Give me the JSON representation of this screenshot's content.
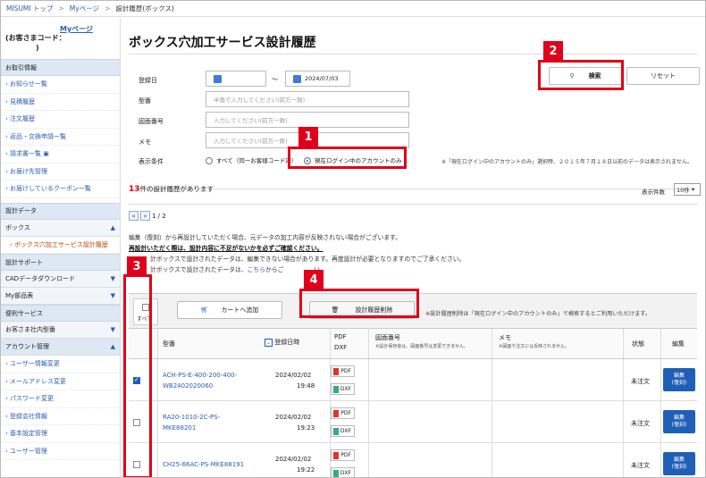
{
  "breadcrumb": {
    "home": "MISUMI トップ",
    "my": "Myページ",
    "current": "設計履歴(ボックス)"
  },
  "sidebar": {
    "mypage": "Myページ",
    "customer_label": "(お客さまコード：",
    "customer_close": ")",
    "sections": [
      {
        "title": "お取引情報",
        "items": [
          "お知らせ一覧",
          "見積履歴",
          "注文履歴",
          "返品・交換申請一覧",
          "請求書一覧",
          "お届け先管理",
          "お届けしているクーポン一覧"
        ]
      },
      {
        "title": "設計データ"
      }
    ],
    "box": "ボックス",
    "box_sub": "ボックス穴加工サービス設計履歴",
    "support": "設計サポート",
    "cad": "CADデータダウンロード",
    "myparts": "My部品表",
    "services": "便利サービス",
    "customer_items": "お客さま社内型番",
    "account": "アカウント管理",
    "account_items": [
      "ユーザー情報変更",
      "メールアドレス変更",
      "パスワード変更",
      "登録会社情報",
      "基本設定管理",
      "ユーザー管理"
    ]
  },
  "page": {
    "title": "ボックス穴加工サービス設計履歴"
  },
  "search": {
    "date_label": "登録日",
    "date_to": "2024/07/03",
    "tilde": "～",
    "part_label": "型番",
    "part_ph": "半角で入力してください(前方一致)",
    "drawing_label": "図面番号",
    "drawing_ph": "入力してください(前方一致)",
    "memo_label": "メモ",
    "memo_ph": "入力してください(前方一致)",
    "cond_label": "表示条件",
    "opt_all": "すべて（同一お客様コード内）",
    "opt_mine": "現在ログイン中のアカウントのみ",
    "note": "※「現在ログイン中のアカウントのみ」選択時、２０１５年７月１８日以前のデータは表示されません。",
    "search_btn": "検索",
    "reset_btn": "リセット"
  },
  "results": {
    "count": "13",
    "count_suffix": "件の設計履歴があります",
    "per_page_label": "表示件数",
    "per_page": "10件",
    "page": "1 / 2",
    "msg1": "編集（復刻）から再設計していただく場合、元データの加工内容が反映されない場合がございます。",
    "msg2": "再設計いただく際は、設計内容に不足がないかを必ずご確認ください。",
    "msg3": "計ボックスで設計されたデータは、編集できない場合があります。再度設計が必要となりますのでご了承ください。",
    "msg4a": "計ボックスで設計されたデータは、",
    "msg4b": "こちら",
    "msg4c": "からご",
    "msg4d": "い。"
  },
  "toolbar": {
    "select_all": "すべて",
    "cart": "カートへ追加",
    "delete": "設計履歴削除",
    "delete_note": "※設計履歴削除は「現在ログイン中のアカウントのみ」で検索するとご利用いただけます。"
  },
  "columns": {
    "part": "型番",
    "date": "登録日時",
    "pdf": "PDF",
    "dxf": "DXF",
    "drawing": "図面番号",
    "drawing_note": "※設計保存後は、図面番号は変更できません。",
    "memo": "メモ",
    "memo_note": "※図面や注文には反映されません。",
    "status": "状態",
    "edit": "編集"
  },
  "rows": [
    {
      "part1": "ACH-PS-E-400-200-400-",
      "part2": "WB2402020060",
      "date": "2024/02/02",
      "time": "19:48",
      "status": "未注文",
      "checked": true
    },
    {
      "part1": "RA20-1010-2C-PS-",
      "part2": "MKE88201",
      "date": "2024/02/02",
      "time": "19:23",
      "status": "未注文",
      "checked": false
    },
    {
      "part1": "CH25-66AC-PS-MKE88191",
      "part2": "",
      "date": "2024/02/02",
      "time": "19:22",
      "status": "未注文",
      "checked": false
    }
  ],
  "doc": {
    "pdf": "PDF",
    "dxf": "DXF"
  },
  "edit_label1": "編集",
  "edit_label2": "(復刻)",
  "badges": [
    "1",
    "2",
    "3",
    "4"
  ]
}
